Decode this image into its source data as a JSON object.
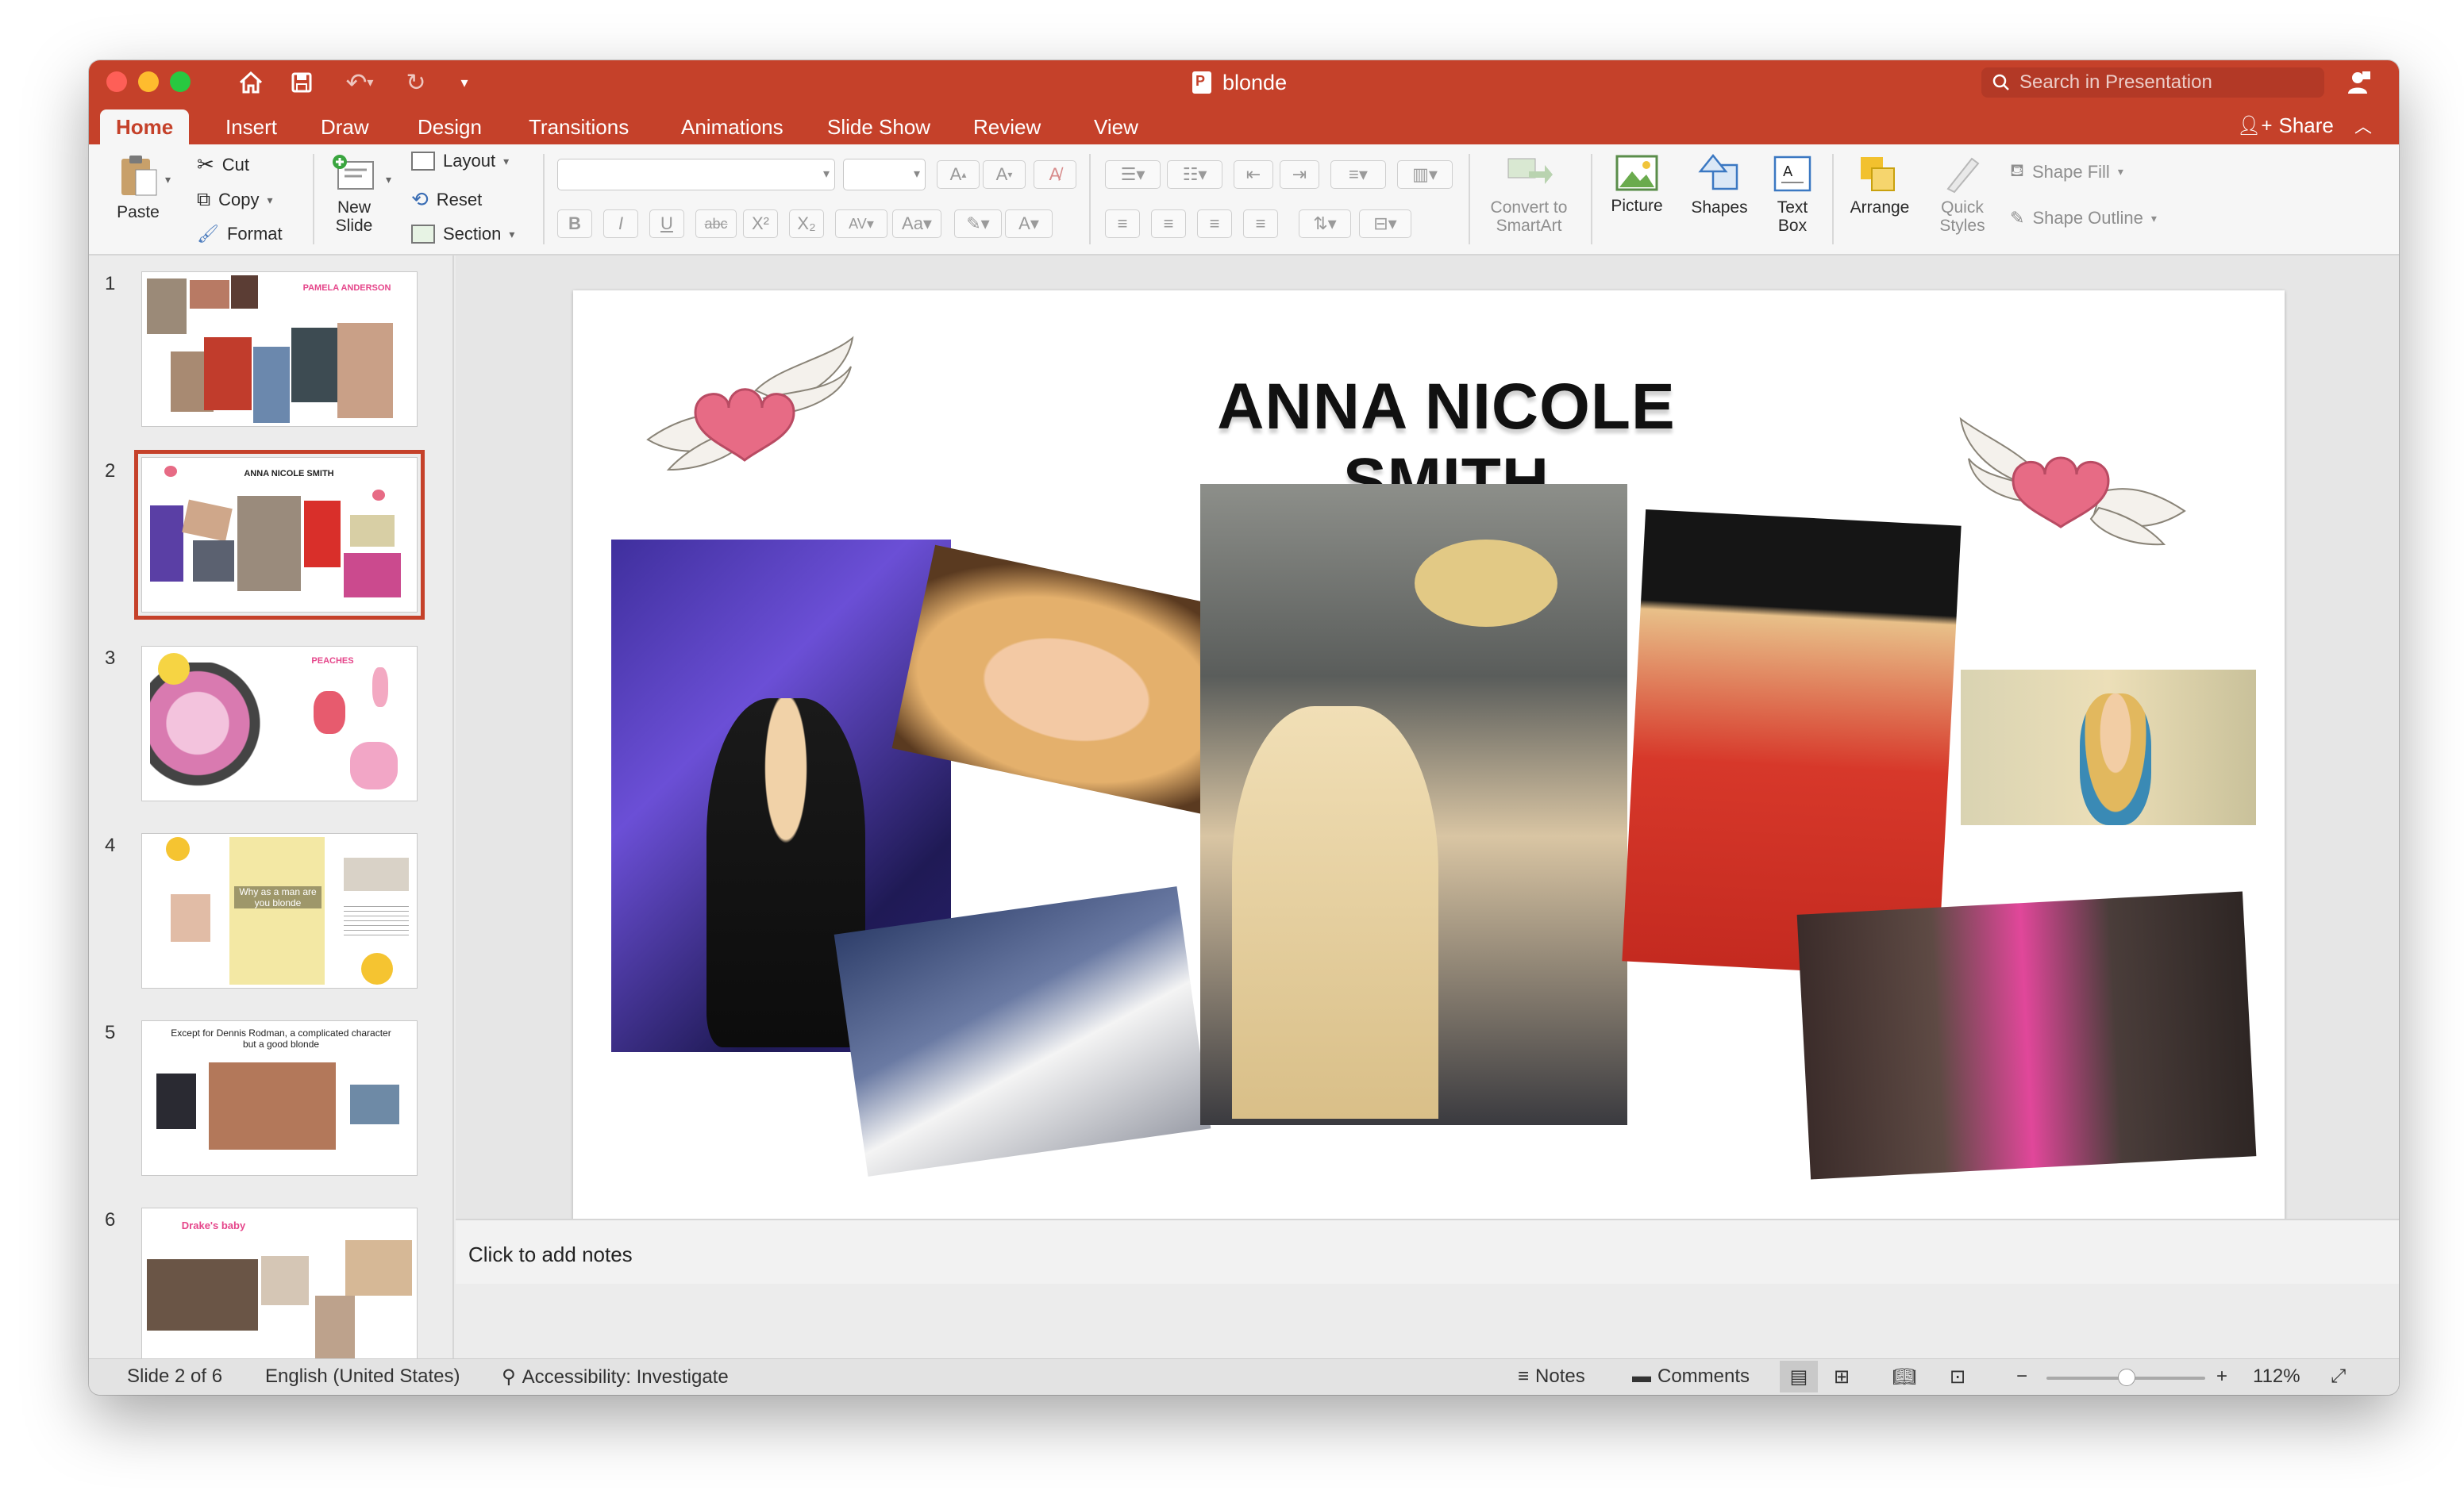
{
  "window": {
    "title": "blonde"
  },
  "titlebar": {
    "search_placeholder": "Search in Presentation"
  },
  "tabs": [
    "Home",
    "Insert",
    "Draw",
    "Design",
    "Transitions",
    "Animations",
    "Slide Show",
    "Review",
    "View"
  ],
  "active_tab": "Home",
  "share_label": "Share",
  "ribbon": {
    "paste": "Paste",
    "cut": "Cut",
    "copy": "Copy",
    "format": "Format",
    "new_slide": "New\nSlide",
    "new_slide_line1": "New",
    "new_slide_line2": "Slide",
    "layout": "Layout",
    "reset": "Reset",
    "section": "Section",
    "convert_line1": "Convert to",
    "convert_line2": "SmartArt",
    "picture": "Picture",
    "shapes": "Shapes",
    "textbox_line1": "Text",
    "textbox_line2": "Box",
    "arrange": "Arrange",
    "quick_line1": "Quick",
    "quick_line2": "Styles",
    "shape_fill": "Shape Fill",
    "shape_outline": "Shape Outline",
    "format_buttons": [
      "B",
      "I",
      "U",
      "abc",
      "X²",
      "X₂"
    ]
  },
  "thumbnails": [
    {
      "number": "1",
      "caption": "PAMELA ANDERSON"
    },
    {
      "number": "2",
      "caption": "ANNA NICOLE SMITH"
    },
    {
      "number": "3",
      "caption": "PEACHES"
    },
    {
      "number": "4",
      "caption": "Why as a man are you blonde"
    },
    {
      "number": "5",
      "caption": "Except for Dennis Rodman, a complicated character but a good blonde"
    },
    {
      "number": "6",
      "caption": "Drake's baby"
    }
  ],
  "slide": {
    "title": "ANNA NICOLE SMITH"
  },
  "notes_placeholder": "Click to add notes",
  "status": {
    "slide_info": "Slide 2 of 6",
    "language": "English (United States)",
    "accessibility": "Accessibility: Investigate",
    "notes": "Notes",
    "comments": "Comments",
    "zoom": "112%"
  },
  "colors": {
    "accent": "#c5412a",
    "heart": "#e76b85"
  }
}
